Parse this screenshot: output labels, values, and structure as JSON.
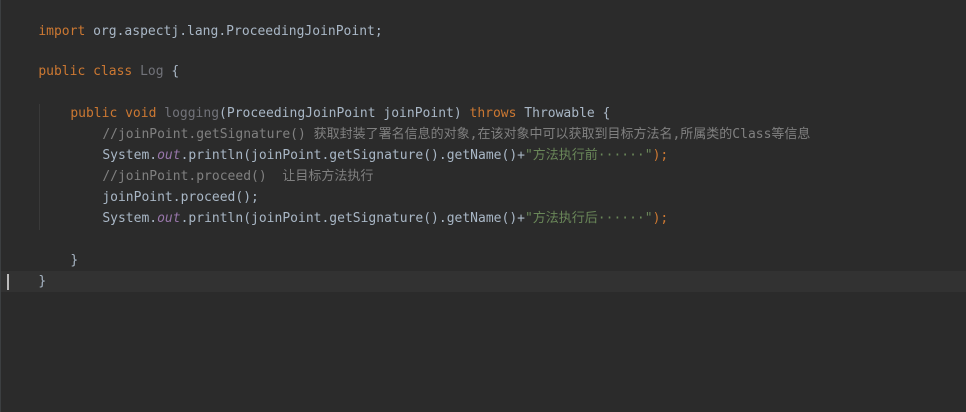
{
  "code": {
    "import_kw": "import",
    "import_path": " org.aspectj.lang.ProceedingJoinPoint;",
    "class_public": "public",
    "class_kw": "class",
    "class_name": "Log",
    "class_open": " {",
    "method_public": "public",
    "method_void": "void",
    "method_name": "logging",
    "method_params": "(ProceedingJoinPoint joinPoint) ",
    "method_throws": "throws",
    "method_throwable": " Throwable {",
    "comment_signature": "//joinPoint.getSignature() 获取封装了署名信息的对象,在该对象中可以获取到目标方法名,所属类的Class等信息",
    "print1_system": "System.",
    "print1_out": "out",
    "print1_call": ".println(joinPoint.getSignature().getName()+",
    "print1_str": "\"方法执行前······\"",
    "print1_end": ");",
    "comment_proceed": "//joinPoint.proceed()  让目标方法执行",
    "proceed_call": "joinPoint.proceed();",
    "print2_system": "System.",
    "print2_out": "out",
    "print2_call": ".println(joinPoint.getSignature().getName()+",
    "print2_str": "\"方法执行后······\"",
    "print2_end": ");",
    "method_close": "}",
    "class_close": "}"
  }
}
